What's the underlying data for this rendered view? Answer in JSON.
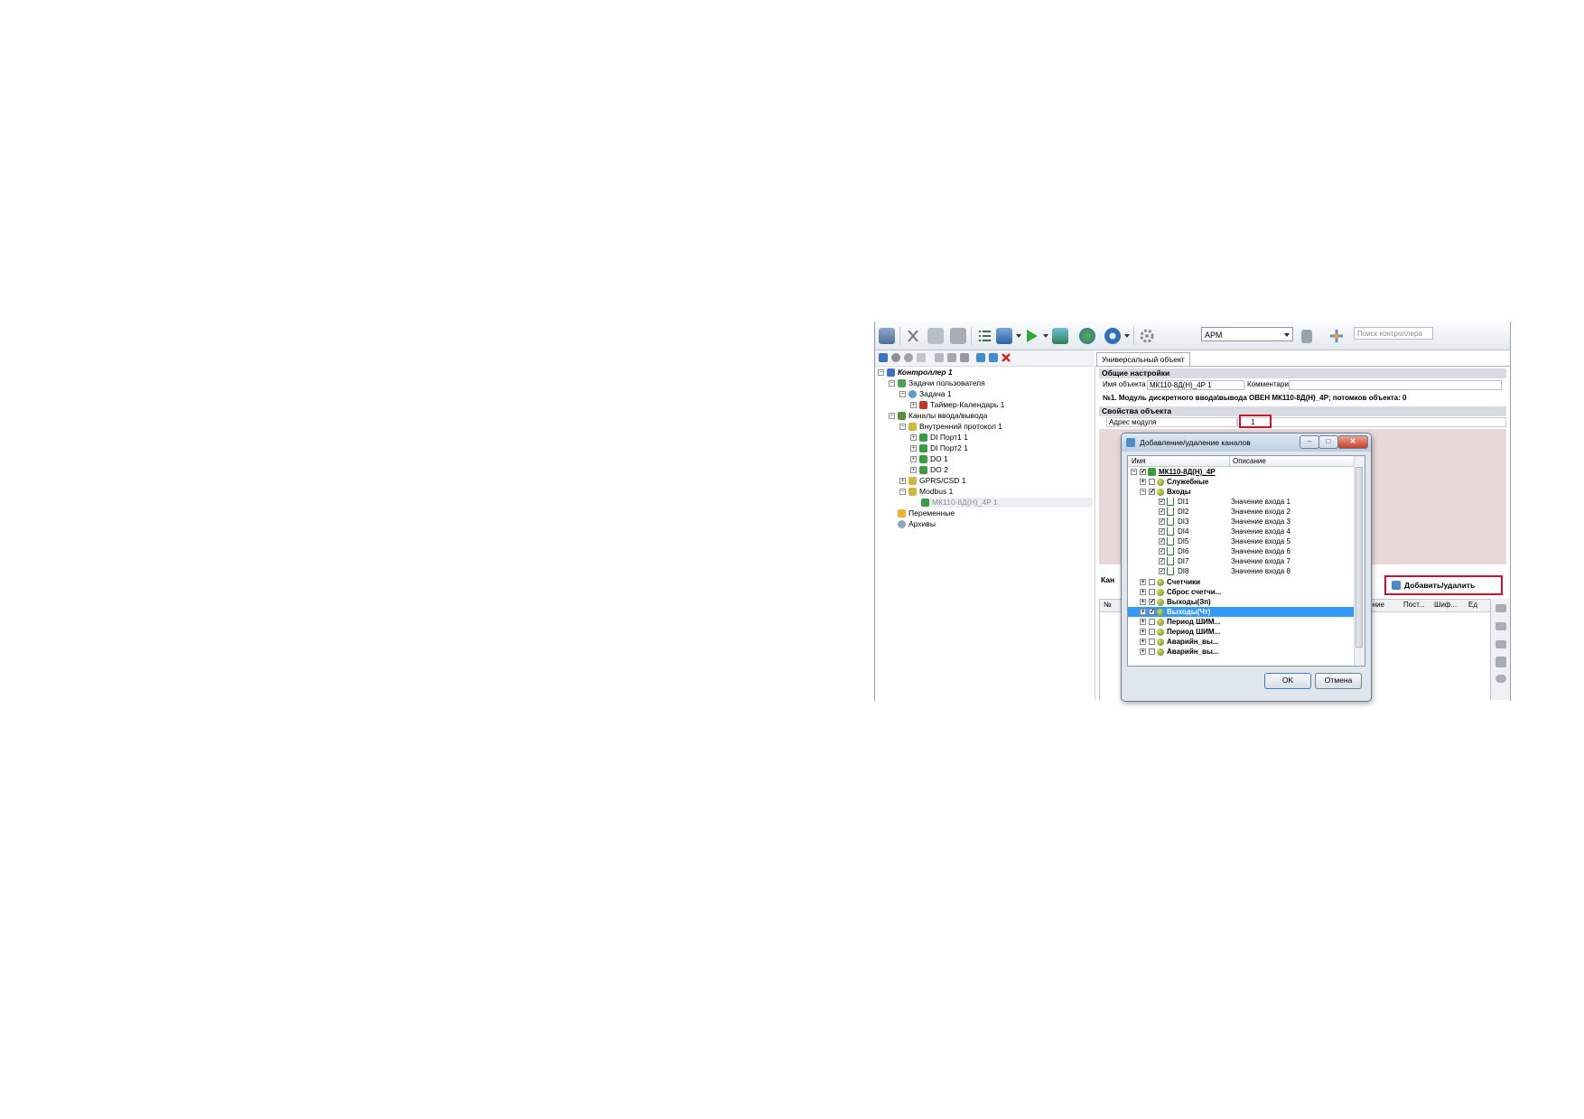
{
  "toolbar": {
    "combo_value": "АРМ",
    "search_placeholder": "Поиск контроллера"
  },
  "tree": {
    "items": [
      {
        "label": "Контроллер 1"
      },
      {
        "label": "Задачи пользователя"
      },
      {
        "label": "Задача 1"
      },
      {
        "label": "Таймер-Календарь 1"
      },
      {
        "label": "Каналы ввода/вывода"
      },
      {
        "label": "Внутренний протокол 1"
      },
      {
        "label": "DI Порт1 1"
      },
      {
        "label": "DI Порт2 1"
      },
      {
        "label": "DO 1"
      },
      {
        "label": "DO 2"
      },
      {
        "label": "GPRS/CSD 1"
      },
      {
        "label": "Modbus 1"
      },
      {
        "label": "МК110-8Д(Н)_4Р 1"
      },
      {
        "label": "Переменные"
      },
      {
        "label": "Архивы"
      }
    ]
  },
  "panel": {
    "tab": "Универсальный объект",
    "general_title": "Общие настройки",
    "name_label": "Имя объекта",
    "name_value": "МК110-8Д(Н)_4Р 1",
    "comment_label": "Комментарий",
    "info": "№1. Модуль дискретного ввода\\вывода ОВЕН МК110-8Д(Н)_4Р; потомков объекта: 0",
    "props_title": "Свойства объекта",
    "address_label": "Адрес модуля",
    "address_value": "1",
    "channels_label": "Кан",
    "add_button": "Добавить/удалить каналы",
    "grid_columns": [
      "№",
      "...ачение",
      "Пост...",
      "Шиф...",
      "Ед"
    ]
  },
  "dialog": {
    "title": "Добавление/удаление каналов",
    "col_name": "Имя",
    "col_desc": "Описание",
    "root": "МК110-8Д(Н)_4Р",
    "groups_top": [
      "Служебные",
      "Входы"
    ],
    "channels": [
      {
        "name": "DI1",
        "desc": "Значение входа 1"
      },
      {
        "name": "DI2",
        "desc": "Значение входа 2"
      },
      {
        "name": "DI3",
        "desc": "Значение входа 3"
      },
      {
        "name": "DI4",
        "desc": "Значение входа 4"
      },
      {
        "name": "DI5",
        "desc": "Значение входа 5"
      },
      {
        "name": "DI6",
        "desc": "Значение входа 6"
      },
      {
        "name": "DI7",
        "desc": "Значение входа 7"
      },
      {
        "name": "DI8",
        "desc": "Значение входа 8"
      }
    ],
    "groups_bottom": [
      "Счетчики",
      "Сброс счетчи...",
      "Выходы(Зп)",
      "Выходы(Чт)",
      "Период ШИМ...",
      "Период ШИМ...",
      "Аварийн_вы...",
      "Аварийн_вы..."
    ],
    "ok": "OK",
    "cancel": "Отмена"
  },
  "colors": {
    "selection": "#3399ff",
    "highlight": "#c8102e",
    "panel_pink": "#ead8d8"
  }
}
